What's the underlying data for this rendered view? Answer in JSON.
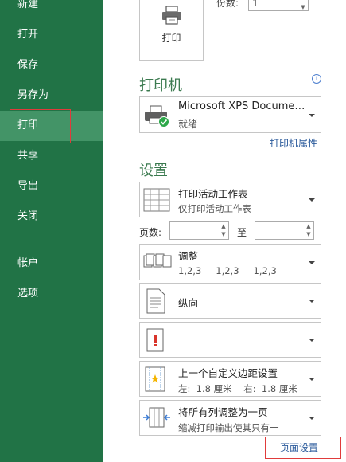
{
  "sidebar": {
    "items": [
      {
        "label": "新建"
      },
      {
        "label": "打开"
      },
      {
        "label": "保存"
      },
      {
        "label": "另存为"
      },
      {
        "label": "打印",
        "active": true
      },
      {
        "label": "共享"
      },
      {
        "label": "导出"
      },
      {
        "label": "关闭"
      },
      {
        "label": "帐户"
      },
      {
        "label": "选项"
      }
    ]
  },
  "print": {
    "button_label": "打印",
    "copies_label": "份数:",
    "copies_value": "1"
  },
  "printer": {
    "section_title": "打印机",
    "name": "Microsoft XPS Docume…",
    "status": "就绪",
    "properties_link": "打印机属性"
  },
  "settings": {
    "section_title": "设置",
    "scope": {
      "main": "打印活动工作表",
      "sub": "仅打印活动工作表"
    },
    "pages_label": "页数:",
    "pages_to": "至",
    "collate": {
      "main": "调整",
      "sub": [
        "1,2,3",
        "1,2,3",
        "1,2,3"
      ]
    },
    "orientation": {
      "main": "纵向"
    },
    "margins": {
      "main": "上一个自定义边距设置",
      "sub": "左:  1.8 厘米    右:  1.8 厘米"
    },
    "scaling": {
      "main": "将所有列调整为一页",
      "sub": "缩减打印输出使其只有一"
    },
    "page_setup_link": "页面设置"
  },
  "colors": {
    "sidebar_bg": "#217346",
    "sidebar_active": "#439467",
    "title_green": "#3b7a4f",
    "link_blue": "#2a5a9b",
    "annotation_red": "#e03b3b"
  }
}
